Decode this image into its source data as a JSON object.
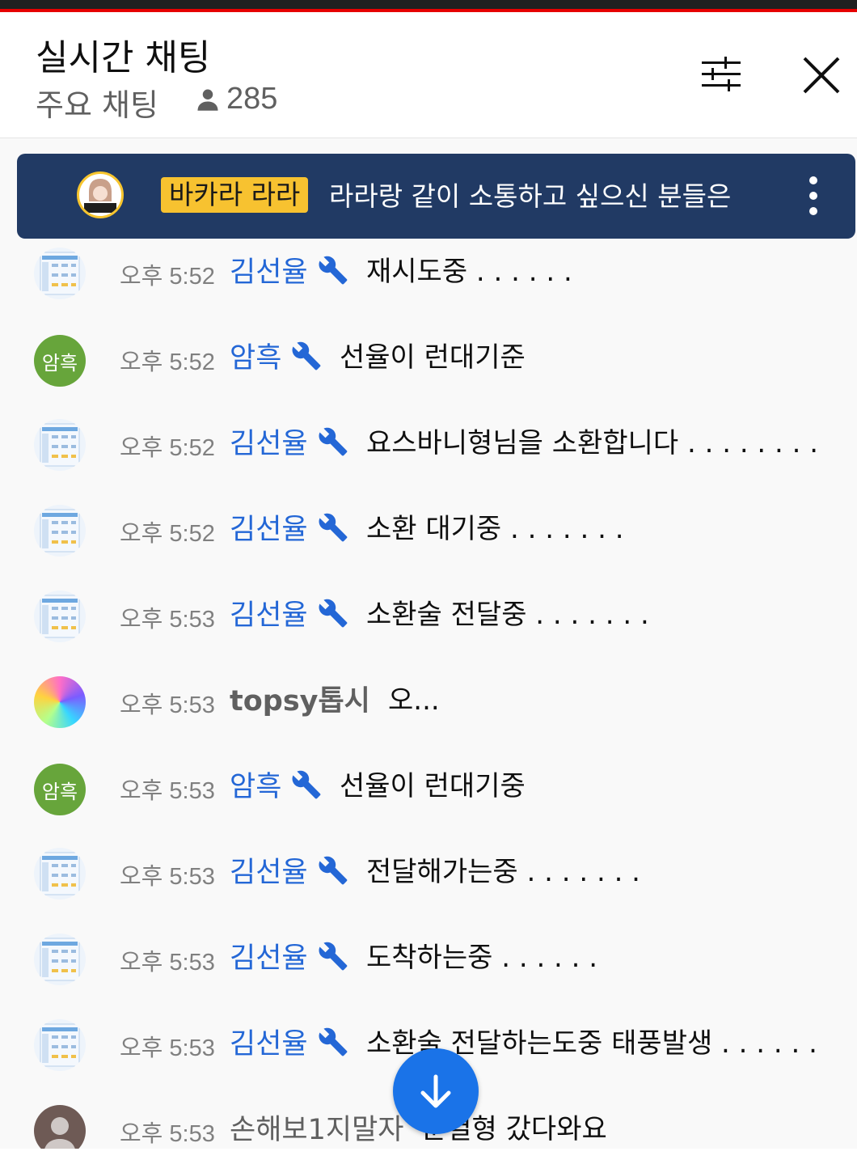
{
  "header": {
    "title": "실시간 채팅",
    "subtitle": "주요 채팅",
    "viewer_count": "285",
    "icons": {
      "viewers": "person-icon",
      "filter": "sliders-icon",
      "close": "close-icon"
    }
  },
  "pinned": {
    "avatar_label": "바카라 라라",
    "author": "바카라 라라",
    "text": "라라랑 같이 소통하고 싶으신 분들은",
    "colors": {
      "background": "#213a64",
      "badge": "#f7c230"
    }
  },
  "messages": [
    {
      "avatar": "thumbnail",
      "time": "오후 5:52",
      "author": "김선율",
      "moderator": true,
      "text": "재시도중 . . . . . ."
    },
    {
      "avatar_text": "암흑",
      "time": "오후 5:52",
      "author": "암흑",
      "moderator": true,
      "text": "선율이 런대기준"
    },
    {
      "avatar": "thumbnail",
      "time": "오후 5:52",
      "author": "김선율",
      "moderator": true,
      "text": "요스바니형님을 소환합니다 . . . . . . . ."
    },
    {
      "avatar": "thumbnail",
      "time": "오후 5:52",
      "author": "김선율",
      "moderator": true,
      "text": "소환 대기중 . . . . . . ."
    },
    {
      "avatar": "thumbnail",
      "time": "오후 5:53",
      "author": "김선율",
      "moderator": true,
      "text": "소환술 전달중 . . . . . . ."
    },
    {
      "avatar": "gem",
      "time": "오후 5:53",
      "author": "topsy톱시",
      "moderator": false,
      "text": "오..."
    },
    {
      "avatar_text": "암흑",
      "time": "오후 5:53",
      "author": "암흑",
      "moderator": true,
      "text": "선율이 런대기중"
    },
    {
      "avatar": "thumbnail",
      "time": "오후 5:53",
      "author": "김선율",
      "moderator": true,
      "text": "전달해가는중 . . . . . . ."
    },
    {
      "avatar": "thumbnail",
      "time": "오후 5:53",
      "author": "김선율",
      "moderator": true,
      "text": "도착하는중 . . . . . ."
    },
    {
      "avatar": "thumbnail",
      "time": "오후 5:53",
      "author": "김선율",
      "moderator": true,
      "text": "소환술 전달하는도중 태풍발생 . . . . . ."
    },
    {
      "avatar": "default",
      "time": "오후 5:53",
      "author": "손해보1지말자",
      "moderator": false,
      "text": "준결형 갔다와요"
    }
  ],
  "scroll_button": {
    "icon": "arrow-down-icon"
  },
  "colors": {
    "author_blue": "#2467d6",
    "accent_red": "#e60000",
    "scroll_button": "#1a73e8"
  }
}
